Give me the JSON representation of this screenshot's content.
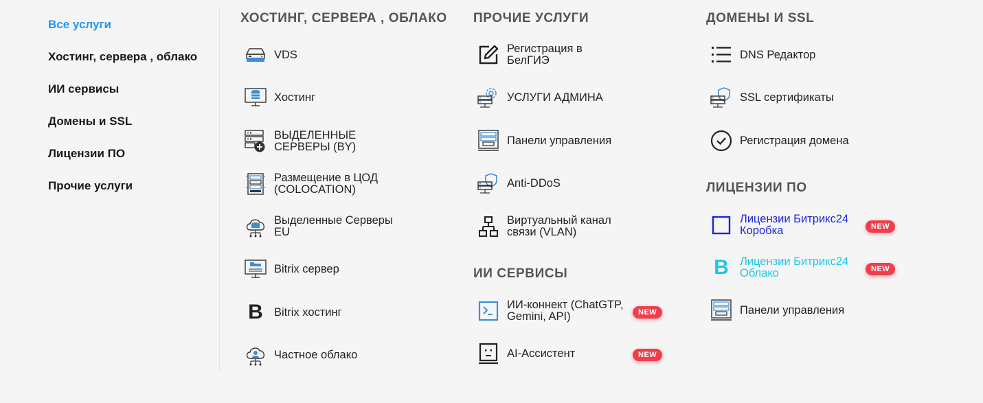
{
  "sidebar": {
    "items": [
      {
        "label": "Все услуги"
      },
      {
        "label": "Хостинг, сервера , облако"
      },
      {
        "label": "ИИ сервисы"
      },
      {
        "label": "Домены и SSL"
      },
      {
        "label": "Лицензии ПО"
      },
      {
        "label": "Прочие услуги"
      }
    ],
    "active_color": "#2196f3"
  },
  "hosting": {
    "title": "ХОСТИНГ, СЕРВЕРА , ОБЛАКО",
    "items": [
      {
        "label": "VDS",
        "icon": "vds-server-icon"
      },
      {
        "label": "Хостинг",
        "icon": "monitor-database-icon"
      },
      {
        "label": "ВЫДЕЛЕННЫЕ СЕРВЕРЫ (BY)",
        "icon": "server-rack-plus-icon"
      },
      {
        "label": "Размещение в ЦОД (COLOCATION)",
        "icon": "server-rack-icon"
      },
      {
        "label": "Выделенные Серверы EU",
        "icon": "cloud-database-icon"
      },
      {
        "label": "Bitrix сервер",
        "icon": "monitor-folder-icon"
      },
      {
        "label": "Bitrix хостинг",
        "icon": "bitrix-b-icon"
      },
      {
        "label": "Частное облако",
        "icon": "private-cloud-icon"
      }
    ]
  },
  "other": {
    "title": "ПРОЧИЕ УСЛУГИ",
    "items": [
      {
        "label": "Регистрация в БелГИЭ",
        "icon": "edit-icon"
      },
      {
        "label": "УСЛУГИ АДМИНА",
        "icon": "server-gear-icon"
      },
      {
        "label": "Панели управления",
        "icon": "control-panel-icon"
      },
      {
        "label": "Anti-DDoS",
        "icon": "server-shield-icon"
      },
      {
        "label": "Виртуальный канал связи (VLAN)",
        "icon": "network-icon"
      }
    ]
  },
  "ai": {
    "title": "ИИ СЕРВИСЫ",
    "items": [
      {
        "label": "ИИ-коннект (ChatGTP, Gemini, API)",
        "icon": "terminal-icon",
        "badge": "NEW"
      },
      {
        "label": "AI-Ассистент",
        "icon": "robot-face-icon",
        "badge": "NEW"
      }
    ]
  },
  "domains": {
    "title": "ДОМЕНЫ И SSL",
    "items": [
      {
        "label": "DNS Редактор",
        "icon": "list-icon"
      },
      {
        "label": "SSL сертификаты",
        "icon": "server-shield-icon"
      },
      {
        "label": "Регистрация домена",
        "icon": "check-circle-icon"
      }
    ]
  },
  "licenses": {
    "title": "ЛИЦЕНЗИИ ПО",
    "items": [
      {
        "label": "Лицензии Битрикс24 Коробка",
        "icon": "box-square-icon",
        "badge": "NEW",
        "color": "#1a26d9"
      },
      {
        "label": "Лицензии Битрикс24 Облако",
        "icon": "bitrix24-b-icon",
        "badge": "NEW",
        "color": "#1ec7e6"
      },
      {
        "label": "Панели управления",
        "icon": "control-panel-icon"
      }
    ]
  },
  "colors": {
    "accent": "#2196f3",
    "badge": "#f03e4b",
    "icon_blue": "#3b8fd9"
  }
}
